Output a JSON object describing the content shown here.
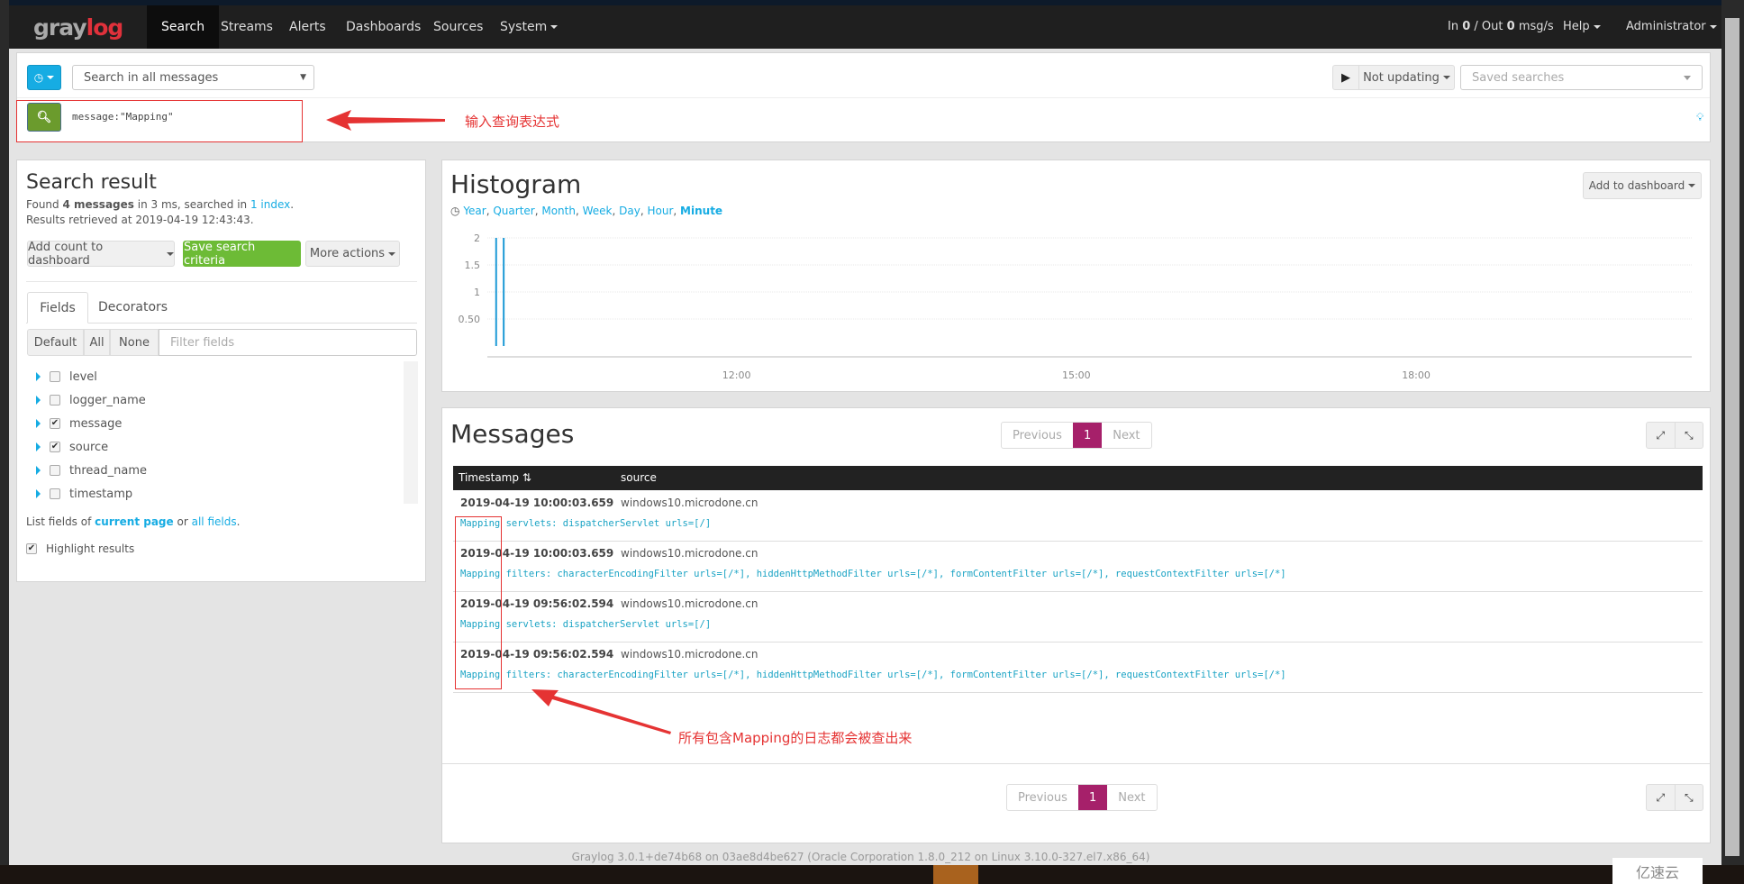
{
  "navbar": {
    "logo": "graylog",
    "items": [
      {
        "label": "Search",
        "active": true
      },
      {
        "label": "Streams"
      },
      {
        "label": "Alerts"
      },
      {
        "label": "Dashboards"
      },
      {
        "label": "Sources"
      },
      {
        "label": "System",
        "dropdown": true
      }
    ],
    "throughput": {
      "in_label": "In",
      "in": "0",
      "out_label": "/ Out",
      "out": "0",
      "unit": "msg/s"
    },
    "help": "Help",
    "user": "Administrator"
  },
  "search": {
    "time_icon": "clock-icon",
    "stream_select": "Search in all messages",
    "query": "message:\"Mapping\"",
    "refresh": "Not updating",
    "saved_searches_placeholder": "Saved searches",
    "hint_icon": "lightbulb-icon"
  },
  "annotations": {
    "query_note": "输入查询表达式",
    "result_note": "所有包含Mapping的日志都会被查出来",
    "color": "#e53333"
  },
  "result": {
    "title": "Search result",
    "found_prefix": "Found",
    "count_label": "4 messages",
    "found_mid": "in 3 ms, searched in",
    "index_link": "1 index",
    "found_suffix": ".",
    "retrieved": "Results retrieved at 2019-04-19 12:43:43.",
    "buttons": {
      "add_count": "Add count to dashboard",
      "save": "Save search criteria",
      "more": "More actions"
    },
    "tabs": [
      "Fields",
      "Decorators"
    ],
    "field_buttons": [
      "Default",
      "All",
      "None"
    ],
    "filter_placeholder": "Filter fields",
    "fields": [
      {
        "name": "level",
        "checked": false
      },
      {
        "name": "logger_name",
        "checked": false
      },
      {
        "name": "message",
        "checked": true
      },
      {
        "name": "source",
        "checked": true
      },
      {
        "name": "thread_name",
        "checked": false
      },
      {
        "name": "timestamp",
        "checked": false
      }
    ],
    "list_prefix": "List fields of",
    "current_page": "current page",
    "list_or": "or",
    "all_fields": "all fields",
    "list_suffix": ".",
    "highlight": "Highlight results",
    "highlight_checked": true
  },
  "histogram": {
    "title": "Histogram",
    "add_to_dashboard": "Add to dashboard",
    "resolutions": [
      "Year",
      "Quarter",
      "Month",
      "Week",
      "Day",
      "Hour",
      "Minute"
    ],
    "active_resolution": "Minute"
  },
  "chart_data": {
    "type": "bar",
    "x": [
      "09:56",
      "10:00"
    ],
    "values": [
      2,
      2
    ],
    "xlim": [
      "09:48",
      "20:26"
    ],
    "xticks": [
      "12:00",
      "15:00",
      "18:00"
    ],
    "ylim": [
      0,
      2
    ],
    "yticks": [
      "0.50",
      "1",
      "1.5",
      "2"
    ],
    "grid": true,
    "color": "#1d9ad6"
  },
  "messages": {
    "title": "Messages",
    "pager": {
      "prev": "Previous",
      "page": "1",
      "next": "Next"
    },
    "columns": [
      "Timestamp",
      "source"
    ],
    "rows": [
      {
        "timestamp": "2019-04-19 10:00:03.659",
        "source": "windows10.microdone.cn",
        "message": "Mapping servlets: dispatcherServlet urls=[/]"
      },
      {
        "timestamp": "2019-04-19 10:00:03.659",
        "source": "windows10.microdone.cn",
        "message": "Mapping filters: characterEncodingFilter urls=[/*], hiddenHttpMethodFilter urls=[/*], formContentFilter urls=[/*], requestContextFilter urls=[/*]"
      },
      {
        "timestamp": "2019-04-19 09:56:02.594",
        "source": "windows10.microdone.cn",
        "message": "Mapping servlets: dispatcherServlet urls=[/]"
      },
      {
        "timestamp": "2019-04-19 09:56:02.594",
        "source": "windows10.microdone.cn",
        "message": "Mapping filters: characterEncodingFilter urls=[/*], hiddenHttpMethodFilter urls=[/*], formContentFilter urls=[/*], requestContextFilter urls=[/*]"
      }
    ]
  },
  "footer": "Graylog 3.0.1+de74b68 on 03ae8d4be627 (Oracle Corporation 1.8.0_212 on Linux 3.10.0-327.el7.x86_64)",
  "watermark": "亿速云",
  "colors": {
    "accent": "#16ace3",
    "green": "#6dbb36",
    "pager_active": "#a6206a",
    "navbar": "#1f1f1f"
  }
}
